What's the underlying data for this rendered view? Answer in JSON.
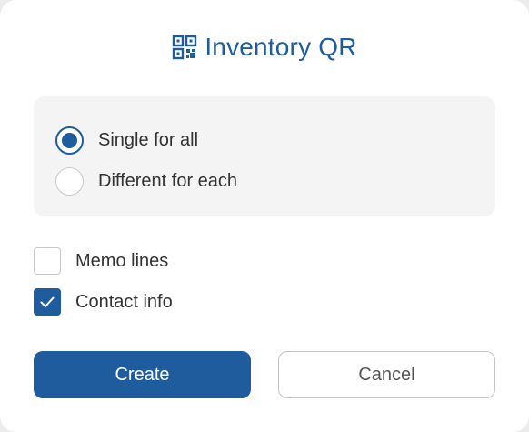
{
  "dialog": {
    "title": "Inventory QR",
    "title_icon": "qr-code-icon",
    "colors": {
      "accent": "#1f5c9e",
      "panel": "#f4f4f4",
      "text": "#333333"
    }
  },
  "qr_mode": {
    "options": [
      {
        "label": "Single for all",
        "selected": true
      },
      {
        "label": "Different for each",
        "selected": false
      }
    ]
  },
  "options": {
    "memo_lines": {
      "label": "Memo lines",
      "checked": false
    },
    "contact_info": {
      "label": "Contact info",
      "checked": true
    }
  },
  "actions": {
    "create_label": "Create",
    "cancel_label": "Cancel"
  }
}
